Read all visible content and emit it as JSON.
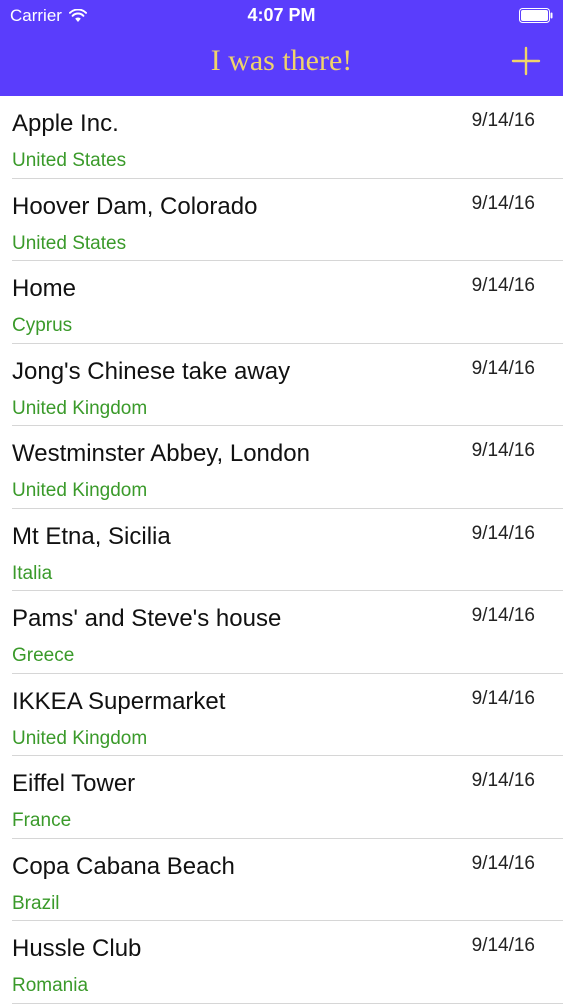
{
  "status_bar": {
    "carrier": "Carrier",
    "time": "4:07 PM"
  },
  "nav": {
    "title": "I was there!",
    "add_icon": "plus-icon"
  },
  "colors": {
    "nav_background": "#5a3dfc",
    "title_color": "#f0d46a",
    "country_color": "#3a9a2a"
  },
  "items": [
    {
      "place": "Apple Inc.",
      "country": "United States",
      "date": "9/14/16"
    },
    {
      "place": "Hoover Dam, Colorado",
      "country": "United States",
      "date": "9/14/16"
    },
    {
      "place": "Home",
      "country": "Cyprus",
      "date": "9/14/16"
    },
    {
      "place": "Jong's Chinese take away",
      "country": "United Kingdom",
      "date": "9/14/16"
    },
    {
      "place": "Westminster Abbey, London",
      "country": "United Kingdom",
      "date": "9/14/16"
    },
    {
      "place": "Mt Etna, Sicilia",
      "country": "Italia",
      "date": "9/14/16"
    },
    {
      "place": "Pams' and Steve's house",
      "country": "Greece",
      "date": "9/14/16"
    },
    {
      "place": "IKKEA Supermarket",
      "country": "United Kingdom",
      "date": "9/14/16"
    },
    {
      "place": "Eiffel Tower",
      "country": "France",
      "date": "9/14/16"
    },
    {
      "place": "Copa Cabana Beach",
      "country": "Brazil",
      "date": "9/14/16"
    },
    {
      "place": "Hussle Club",
      "country": "Romania",
      "date": "9/14/16"
    }
  ]
}
